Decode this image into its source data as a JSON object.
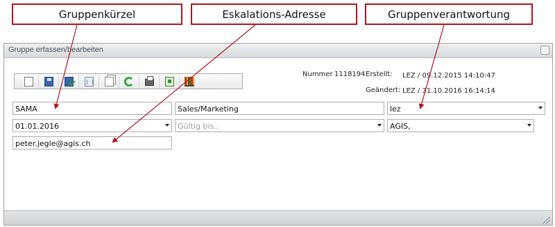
{
  "callouts": {
    "group_short": "Gruppenkürzel",
    "escalation": "Eskalations-Adresse",
    "responsibility": "Gruppenverantwortung"
  },
  "panel": {
    "title": "Gruppe erfassen/bearbeiten"
  },
  "toolbar": {
    "icons": [
      "new-document-icon",
      "save-icon",
      "save-and-check-icon",
      "delete-icon",
      "copy-icon",
      "refresh-icon",
      "print-icon",
      "export-icon",
      "books-icon"
    ]
  },
  "meta": {
    "nummer_label": "Nummer",
    "nummer_value": "1118194",
    "erstellt_label": "Erstellt:",
    "erstellt_value": "LEZ / 09.12.2015 14:10:47",
    "geaendert_label": "Geändert:",
    "geaendert_value": "LEZ / 31.10.2016 16:14:14"
  },
  "form": {
    "short_name": "SAMA",
    "name": "Sales/Marketing",
    "owner": "lez",
    "valid_from": "01.01.2016",
    "valid_to_placeholder": "Gültig bis..",
    "company": "AGIS,",
    "escalation_email": "peter.jegle@agis.ch"
  },
  "colors": {
    "callout_border": "#b3121a",
    "arrow": "#b3121a"
  }
}
